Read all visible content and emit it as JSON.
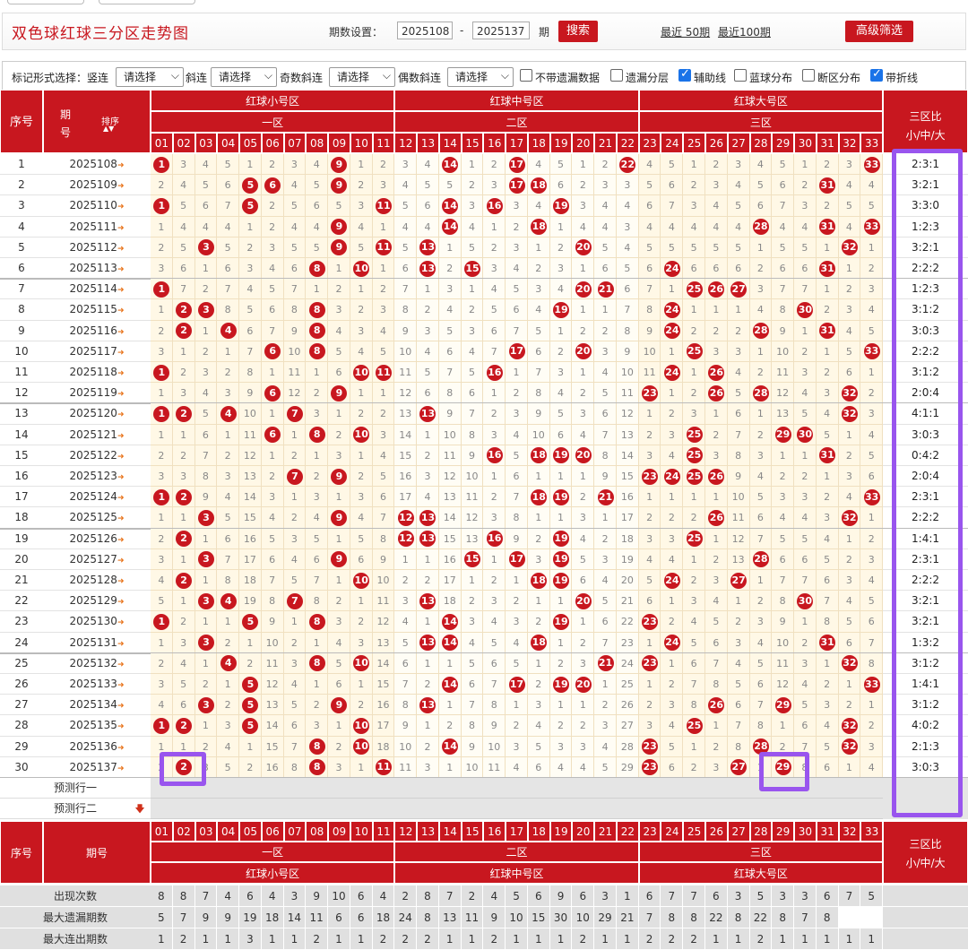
{
  "title": "双色球红球三分区走势图",
  "period_setting": {
    "label": "期数设置：",
    "from": "2025108",
    "to": "2025137",
    "dash": "-",
    "unit": "期",
    "search": "搜索"
  },
  "quick_links": [
    "最近 50期",
    "最近100期"
  ],
  "advanced_filter": "高级筛选",
  "options": {
    "mark_label": "标记形式选择：竖连",
    "oblique_label": "斜连",
    "odd_label": "奇数斜连",
    "even_label": "偶数斜连",
    "select_placeholder": "请选择",
    "checkboxes": [
      {
        "label": "不带遗漏数据",
        "checked": false
      },
      {
        "label": "遗漏分层",
        "checked": false
      },
      {
        "label": "辅助线",
        "checked": true
      },
      {
        "label": "蓝球分布",
        "checked": false
      },
      {
        "label": "断区分布",
        "checked": false
      },
      {
        "label": "带折线",
        "checked": true
      }
    ]
  },
  "header": {
    "seq": "序号",
    "period_top": "期",
    "period_bottom": "号",
    "sort": "排序",
    "sort_arrows": "▲▼",
    "period_full": "期号",
    "zones": [
      "红球小号区",
      "红球中号区",
      "红球大号区"
    ],
    "subzones": [
      "一区",
      "二区",
      "三区"
    ],
    "ratio_title": "三区比",
    "ratio_sub": "小/中/大"
  },
  "numbers": [
    "01",
    "02",
    "03",
    "04",
    "05",
    "06",
    "07",
    "08",
    "09",
    "10",
    "11",
    "12",
    "13",
    "14",
    "15",
    "16",
    "17",
    "18",
    "19",
    "20",
    "21",
    "22",
    "23",
    "24",
    "25",
    "26",
    "27",
    "28",
    "29",
    "30",
    "31",
    "32",
    "33"
  ],
  "rows": [
    {
      "seq": "1",
      "period": "2025108",
      "drawn": [
        1,
        9,
        14,
        17,
        22,
        33
      ],
      "ratio": "2:3:1"
    },
    {
      "seq": "2",
      "period": "2025109",
      "drawn": [
        5,
        6,
        9,
        17,
        18,
        31
      ],
      "ratio": "3:2:1"
    },
    {
      "seq": "3",
      "period": "2025110",
      "drawn": [
        1,
        5,
        11,
        14,
        16,
        19
      ],
      "ratio": "3:3:0"
    },
    {
      "seq": "4",
      "period": "2025111",
      "drawn": [
        9,
        14,
        18,
        28,
        31,
        33
      ],
      "ratio": "1:2:3"
    },
    {
      "seq": "5",
      "period": "2025112",
      "drawn": [
        3,
        9,
        11,
        13,
        20,
        32
      ],
      "ratio": "3:2:1"
    },
    {
      "seq": "6",
      "period": "2025113",
      "drawn": [
        8,
        10,
        13,
        15,
        24,
        31
      ],
      "ratio": "2:2:2"
    },
    {
      "seq": "7",
      "period": "2025114",
      "drawn": [
        1,
        20,
        21,
        25,
        26,
        27
      ],
      "ratio": "1:2:3"
    },
    {
      "seq": "8",
      "period": "2025115",
      "drawn": [
        2,
        3,
        8,
        19,
        24,
        30
      ],
      "ratio": "3:1:2"
    },
    {
      "seq": "9",
      "period": "2025116",
      "drawn": [
        2,
        4,
        8,
        24,
        28,
        31
      ],
      "ratio": "3:0:3"
    },
    {
      "seq": "10",
      "period": "2025117",
      "drawn": [
        6,
        8,
        17,
        20,
        25,
        33
      ],
      "ratio": "2:2:2"
    },
    {
      "seq": "11",
      "period": "2025118",
      "drawn": [
        1,
        10,
        11,
        16,
        24,
        26
      ],
      "ratio": "3:1:2"
    },
    {
      "seq": "12",
      "period": "2025119",
      "drawn": [
        6,
        9,
        23,
        26,
        28,
        32
      ],
      "ratio": "2:0:4"
    },
    {
      "seq": "13",
      "period": "2025120",
      "drawn": [
        1,
        2,
        4,
        7,
        13,
        32
      ],
      "ratio": "4:1:1"
    },
    {
      "seq": "14",
      "period": "2025121",
      "drawn": [
        6,
        8,
        10,
        25,
        29,
        30
      ],
      "ratio": "3:0:3"
    },
    {
      "seq": "15",
      "period": "2025122",
      "drawn": [
        16,
        18,
        19,
        20,
        25,
        31
      ],
      "ratio": "0:4:2"
    },
    {
      "seq": "16",
      "period": "2025123",
      "drawn": [
        7,
        9,
        23,
        24,
        25,
        26
      ],
      "ratio": "2:0:4"
    },
    {
      "seq": "17",
      "period": "2025124",
      "drawn": [
        1,
        2,
        18,
        19,
        21,
        33
      ],
      "ratio": "2:3:1"
    },
    {
      "seq": "18",
      "period": "2025125",
      "drawn": [
        3,
        9,
        12,
        13,
        26,
        32
      ],
      "ratio": "2:2:2"
    },
    {
      "seq": "19",
      "period": "2025126",
      "drawn": [
        2,
        12,
        13,
        16,
        19,
        25
      ],
      "ratio": "1:4:1"
    },
    {
      "seq": "20",
      "period": "2025127",
      "drawn": [
        3,
        9,
        15,
        17,
        19,
        28
      ],
      "ratio": "2:3:1"
    },
    {
      "seq": "21",
      "period": "2025128",
      "drawn": [
        2,
        10,
        18,
        19,
        24,
        27
      ],
      "ratio": "2:2:2"
    },
    {
      "seq": "22",
      "period": "2025129",
      "drawn": [
        3,
        4,
        7,
        13,
        20,
        30
      ],
      "ratio": "3:2:1"
    },
    {
      "seq": "23",
      "period": "2025130",
      "drawn": [
        1,
        5,
        8,
        14,
        19,
        23
      ],
      "ratio": "3:2:1"
    },
    {
      "seq": "24",
      "period": "2025131",
      "drawn": [
        3,
        13,
        14,
        18,
        24,
        31
      ],
      "ratio": "1:3:2"
    },
    {
      "seq": "25",
      "period": "2025132",
      "drawn": [
        4,
        8,
        10,
        21,
        23,
        32
      ],
      "ratio": "3:1:2"
    },
    {
      "seq": "26",
      "period": "2025133",
      "drawn": [
        5,
        14,
        17,
        19,
        20,
        33
      ],
      "ratio": "1:4:1"
    },
    {
      "seq": "27",
      "period": "2025134",
      "drawn": [
        3,
        5,
        9,
        13,
        26,
        29
      ],
      "ratio": "3:1:2"
    },
    {
      "seq": "28",
      "period": "2025135",
      "drawn": [
        1,
        2,
        5,
        10,
        25,
        32
      ],
      "ratio": "4:0:2"
    },
    {
      "seq": "29",
      "period": "2025136",
      "drawn": [
        8,
        10,
        14,
        23,
        28,
        32
      ],
      "ratio": "2:1:3"
    },
    {
      "seq": "30",
      "period": "2025137",
      "drawn": [
        2,
        8,
        11,
        23,
        27,
        29
      ],
      "ratio": "3:0:3"
    }
  ],
  "forecast_rows": [
    "预测行一",
    "预测行二"
  ],
  "forecast_arrow": "🡇",
  "stats": [
    {
      "label": "出现次数",
      "values": [
        "8",
        "8",
        "7",
        "4",
        "6",
        "4",
        "3",
        "9",
        "10",
        "6",
        "4",
        "2",
        "8",
        "7",
        "2",
        "4",
        "5",
        "6",
        "9",
        "6",
        "3",
        "1",
        "6",
        "7",
        "7",
        "6",
        "3",
        "5",
        "3",
        "3",
        "6",
        "7",
        "5"
      ]
    },
    {
      "label": "最大遗漏期数",
      "values": [
        "5",
        "7",
        "9",
        "9",
        "19",
        "18",
        "14",
        "11",
        "6",
        "6",
        "18",
        "24",
        "8",
        "13",
        "11",
        "9",
        "10",
        "15",
        "30",
        "10",
        "29",
        "21",
        "7",
        "8",
        "8",
        "22",
        "8",
        "22",
        "8",
        "7",
        "8"
      ]
    },
    {
      "label": "最大连出期数",
      "values": [
        "1",
        "2",
        "1",
        "1",
        "3",
        "1",
        "1",
        "2",
        "1",
        "1",
        "2",
        "2",
        "2",
        "1",
        "1",
        "2",
        "1",
        "1",
        "1",
        "2",
        "1",
        "1",
        "2",
        "2",
        "2",
        "1",
        "1",
        "2",
        "1",
        "1",
        "1",
        "1",
        "1"
      ]
    }
  ],
  "colors": {
    "brand_red": "#c8171f",
    "row_odd": "#fff8e6",
    "highlight": "#9955ee",
    "sidebar_blue": "#e8ecf8"
  }
}
